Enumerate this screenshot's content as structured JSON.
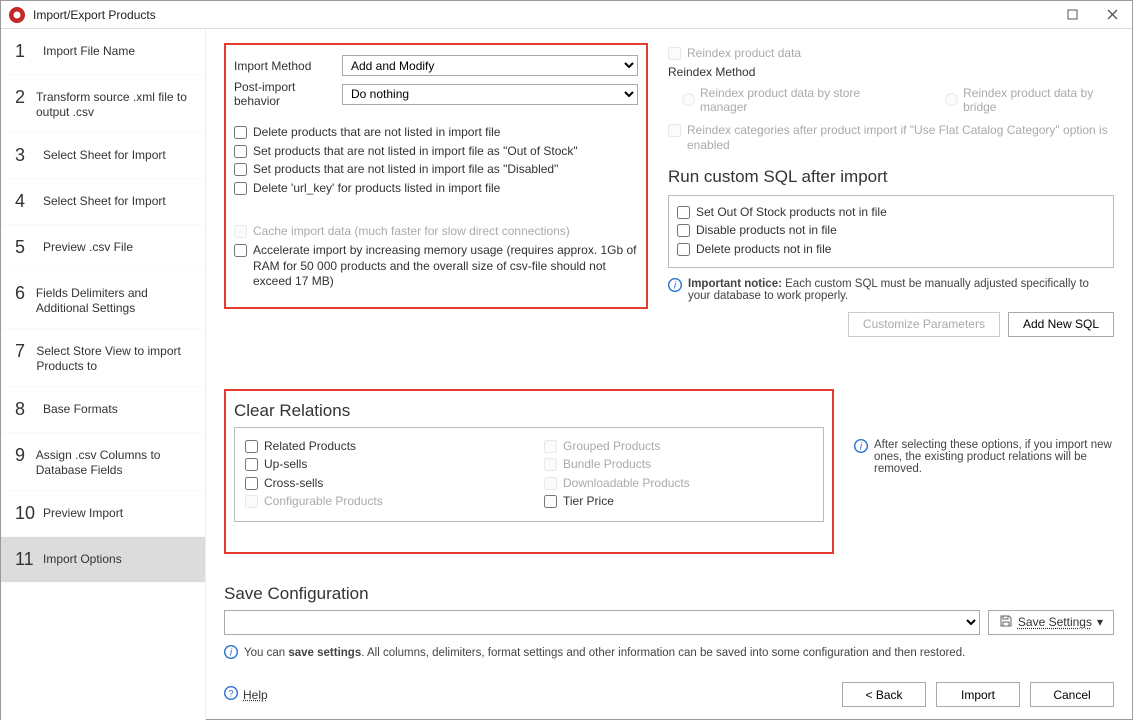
{
  "window": {
    "title": "Import/Export Products"
  },
  "steps": [
    {
      "num": "1",
      "label": "Import File Name"
    },
    {
      "num": "2",
      "label": "Transform source .xml file to output .csv"
    },
    {
      "num": "3",
      "label": "Select Sheet for Import"
    },
    {
      "num": "4",
      "label": "Select Sheet for Import"
    },
    {
      "num": "5",
      "label": "Preview .csv File"
    },
    {
      "num": "6",
      "label": "Fields Delimiters and Additional Settings"
    },
    {
      "num": "7",
      "label": "Select Store View to import Products to"
    },
    {
      "num": "8",
      "label": "Base Formats"
    },
    {
      "num": "9",
      "label": "Assign .csv Columns to Database Fields"
    },
    {
      "num": "10",
      "label": "Preview Import"
    },
    {
      "num": "11",
      "label": "Import Options"
    }
  ],
  "importMethod": {
    "label": "Import Method",
    "value": "Add and Modify"
  },
  "postImport": {
    "label": "Post-import behavior",
    "value": "Do nothing"
  },
  "chk": {
    "deleteNotListed": "Delete products that are not listed in import file",
    "setOOS": "Set products that are not listed in import file as \"Out of Stock\"",
    "setDisabled": "Set products that are not listed in import file as \"Disabled\"",
    "deleteUrlKey": "Delete 'url_key' for products listed in import file",
    "cache": "Cache import data (much faster for slow direct connections)",
    "accelerate": "Accelerate import by increasing memory usage (requires approx. 1Gb of RAM for 50 000 products and the overall size of csv-file should not exceed 17 MB)"
  },
  "reindex": {
    "chk": "Reindex product data",
    "method": "Reindex Method",
    "byMgr": "Reindex product data by store manager",
    "byBridge": "Reindex product data by bridge",
    "cats": "Reindex categories after product import if \"Use Flat Catalog Category\" option is enabled"
  },
  "sql": {
    "title": "Run custom SQL after import",
    "set_oos": "Set Out Of Stock products not in file",
    "disable": "Disable products not in file",
    "delete": "Delete products not in file",
    "noticeBold": "Important notice:",
    "notice": "Each custom SQL must be manually adjusted specifically to your database to work properly.",
    "customize": "Customize Parameters",
    "addnew": "Add New SQL"
  },
  "clearRel": {
    "title": "Clear Relations",
    "related": "Related Products",
    "upsells": "Up-sells",
    "cross": "Cross-sells",
    "config": "Configurable Products",
    "grouped": "Grouped Products",
    "bundle": "Bundle Products",
    "download": "Downloadable Products",
    "tier": "Tier Price",
    "notice": "After selecting these options, if you import new ones, the existing product relations will be removed."
  },
  "save": {
    "title": "Save Configuration",
    "btn": "Save Settings",
    "hintPrefix": "You can ",
    "hintBold": "save settings",
    "hintSuffix": ". All columns, delimiters, format settings and other information can be saved into some configuration and then restored."
  },
  "bottom": {
    "help": "Help",
    "back": "< Back",
    "import": "Import",
    "cancel": "Cancel"
  }
}
